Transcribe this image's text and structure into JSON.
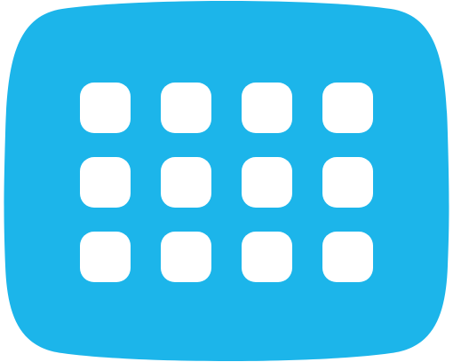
{
  "icon": {
    "name": "keypad-grid-icon",
    "shape": "rounded-squircle",
    "background_color": "#1CB5EA",
    "key_color": "#FFFFFF",
    "grid_rows": 3,
    "grid_columns": 4,
    "key_count": 12
  }
}
